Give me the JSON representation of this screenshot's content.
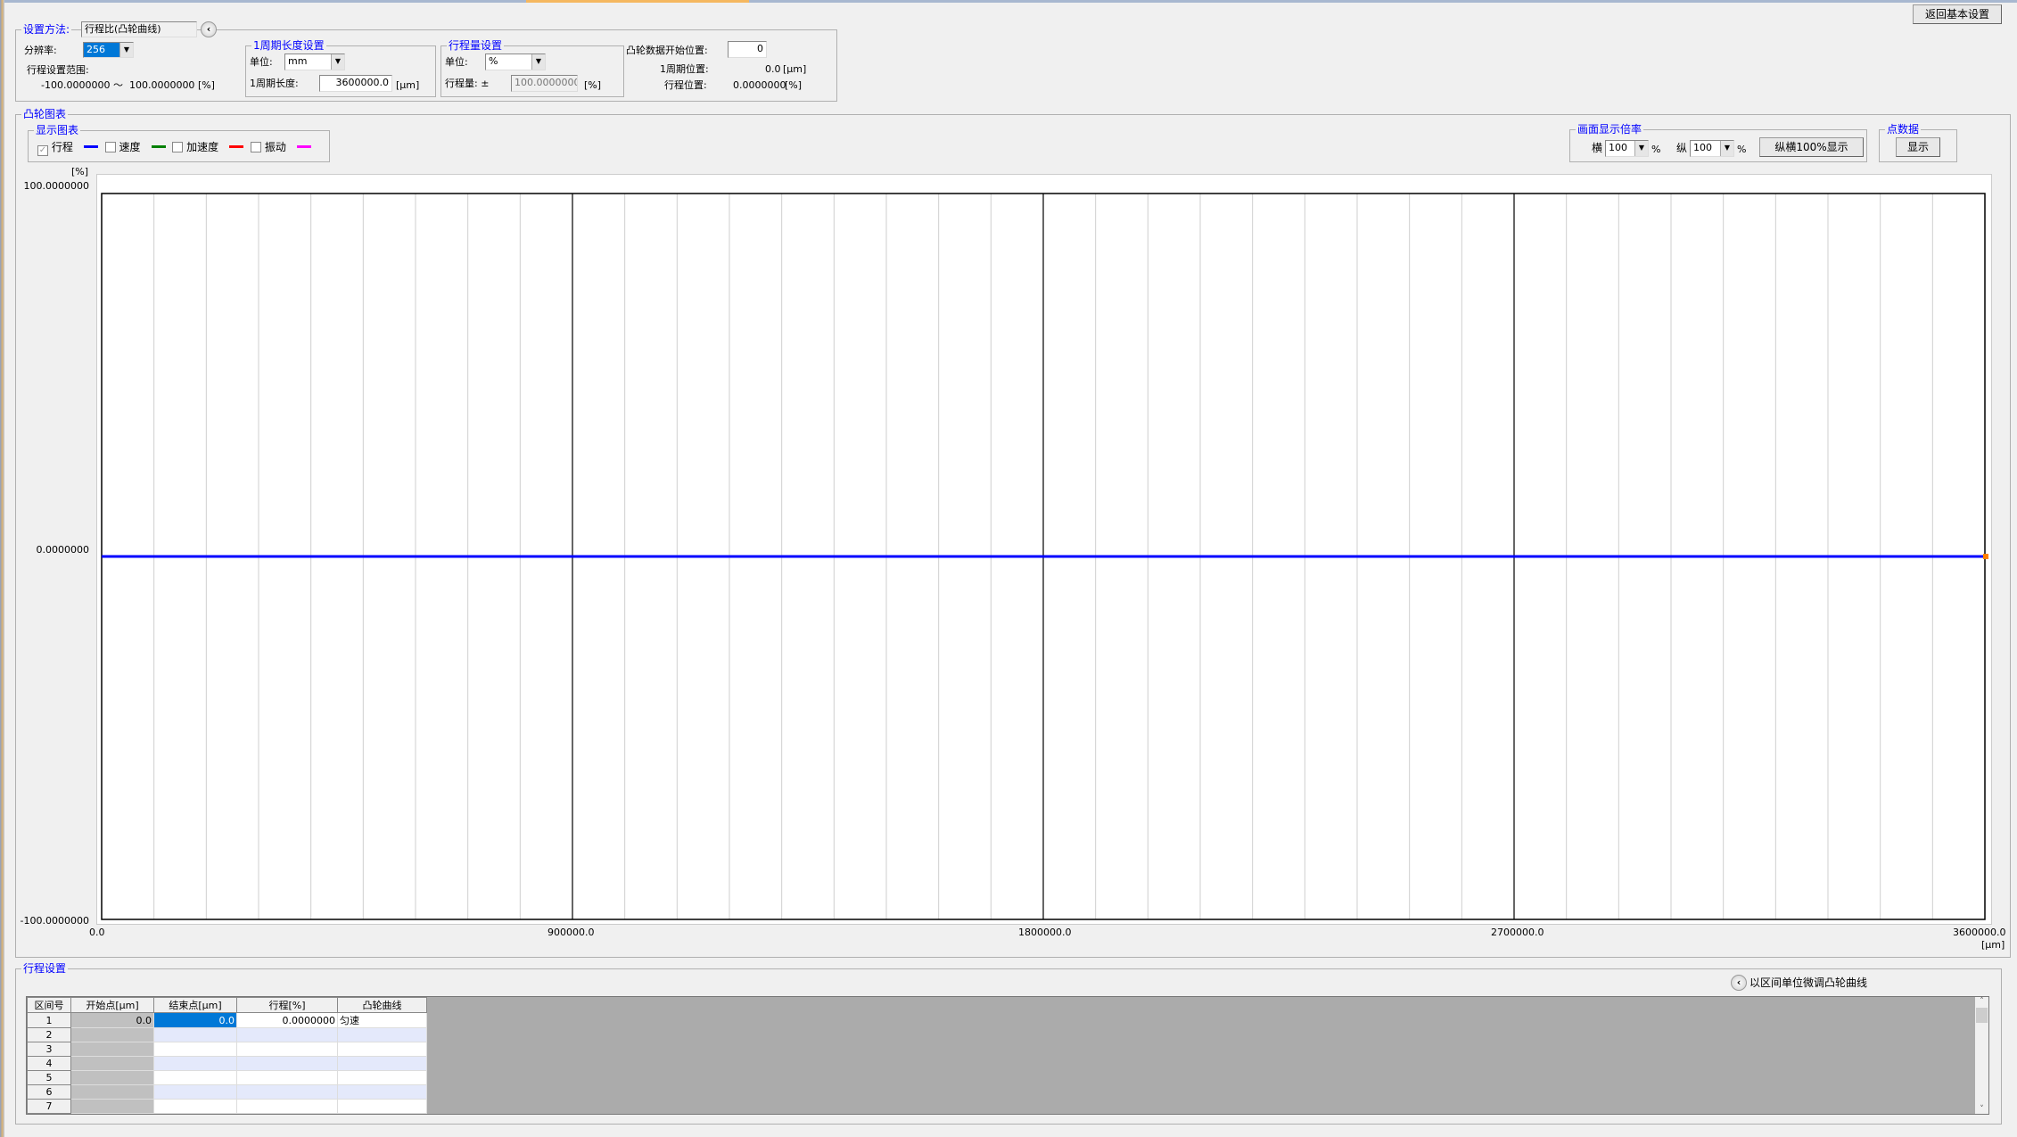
{
  "header": {
    "return_button": "返回基本设置"
  },
  "settings": {
    "method_label": "设置方法:",
    "method_value": "行程比(凸轮曲线)",
    "resolution_label": "分辨率:",
    "resolution_value": "256",
    "range_label": "行程设置范围:",
    "range_min": "-100.0000000",
    "range_sep": "～",
    "range_max": "100.0000000",
    "range_unit": "[%]",
    "period": {
      "title": "1周期长度设置",
      "unit_label": "单位:",
      "unit_value": "mm",
      "length_label": "1周期长度:",
      "length_value": "3600000.0",
      "length_unit": "[μm]"
    },
    "stroke": {
      "title": "行程量设置",
      "unit_label": "单位:",
      "unit_value": "%",
      "amount_label": "行程量:",
      "pm": "±",
      "amount_value": "100.0000000",
      "amount_unit": "[%]"
    },
    "start": {
      "label": "凸轮数据开始位置:",
      "value": "0",
      "period_pos_label": "1周期位置:",
      "period_pos_value": "0.0",
      "period_pos_unit": "[μm]",
      "stroke_pos_label": "行程位置:",
      "stroke_pos_value": "0.0000000",
      "stroke_pos_unit": "[%]"
    }
  },
  "cam_chart": {
    "title": "凸轮图表",
    "display": {
      "title": "显示图表",
      "items": [
        {
          "label": "行程",
          "checked": true,
          "color": "#0000ff"
        },
        {
          "label": "速度",
          "checked": false,
          "color": "#008000"
        },
        {
          "label": "加速度",
          "checked": false,
          "color": "#ff0000"
        },
        {
          "label": "振动",
          "checked": false,
          "color": "#ff00ff"
        }
      ]
    },
    "zoom": {
      "title": "画面显示倍率",
      "h_label": "横",
      "h_value": "100",
      "pct": "%",
      "v_label": "纵",
      "v_value": "100",
      "reset_button": "纵横100%显示"
    },
    "points": {
      "title": "点数据",
      "show_button": "显示"
    }
  },
  "chart_data": {
    "type": "line",
    "ylabel": "[%]",
    "xlabel": "[μm]",
    "ylim": [
      -100,
      100
    ],
    "xlim": [
      0,
      3600000
    ],
    "yticks": [
      "100.0000000",
      "0.0000000",
      "-100.0000000"
    ],
    "xticks": [
      "0.0",
      "900000.0",
      "1800000.0",
      "2700000.0",
      "3600000.0"
    ],
    "minor_x_step": 100000,
    "grid": true,
    "series": [
      {
        "color": "#0000ff",
        "x": [
          0,
          3600000
        ],
        "y": [
          0,
          0
        ]
      }
    ],
    "end_marker_color": "#ff8000"
  },
  "stroke_settings": {
    "title": "行程设置",
    "fine_tune": "以区间单位微调凸轮曲线",
    "columns": [
      "区间号",
      "开始点[μm]",
      "结束点[μm]",
      "行程[%]",
      "凸轮曲线"
    ],
    "rows": [
      [
        "1",
        "0.0",
        "0.0",
        "0.0000000",
        "匀速"
      ],
      [
        "2",
        "",
        "",
        "",
        ""
      ],
      [
        "3",
        "",
        "",
        "",
        ""
      ],
      [
        "4",
        "",
        "",
        "",
        ""
      ],
      [
        "5",
        "",
        "",
        "",
        ""
      ],
      [
        "6",
        "",
        "",
        "",
        ""
      ],
      [
        "7",
        "",
        "",
        "",
        ""
      ]
    ]
  }
}
